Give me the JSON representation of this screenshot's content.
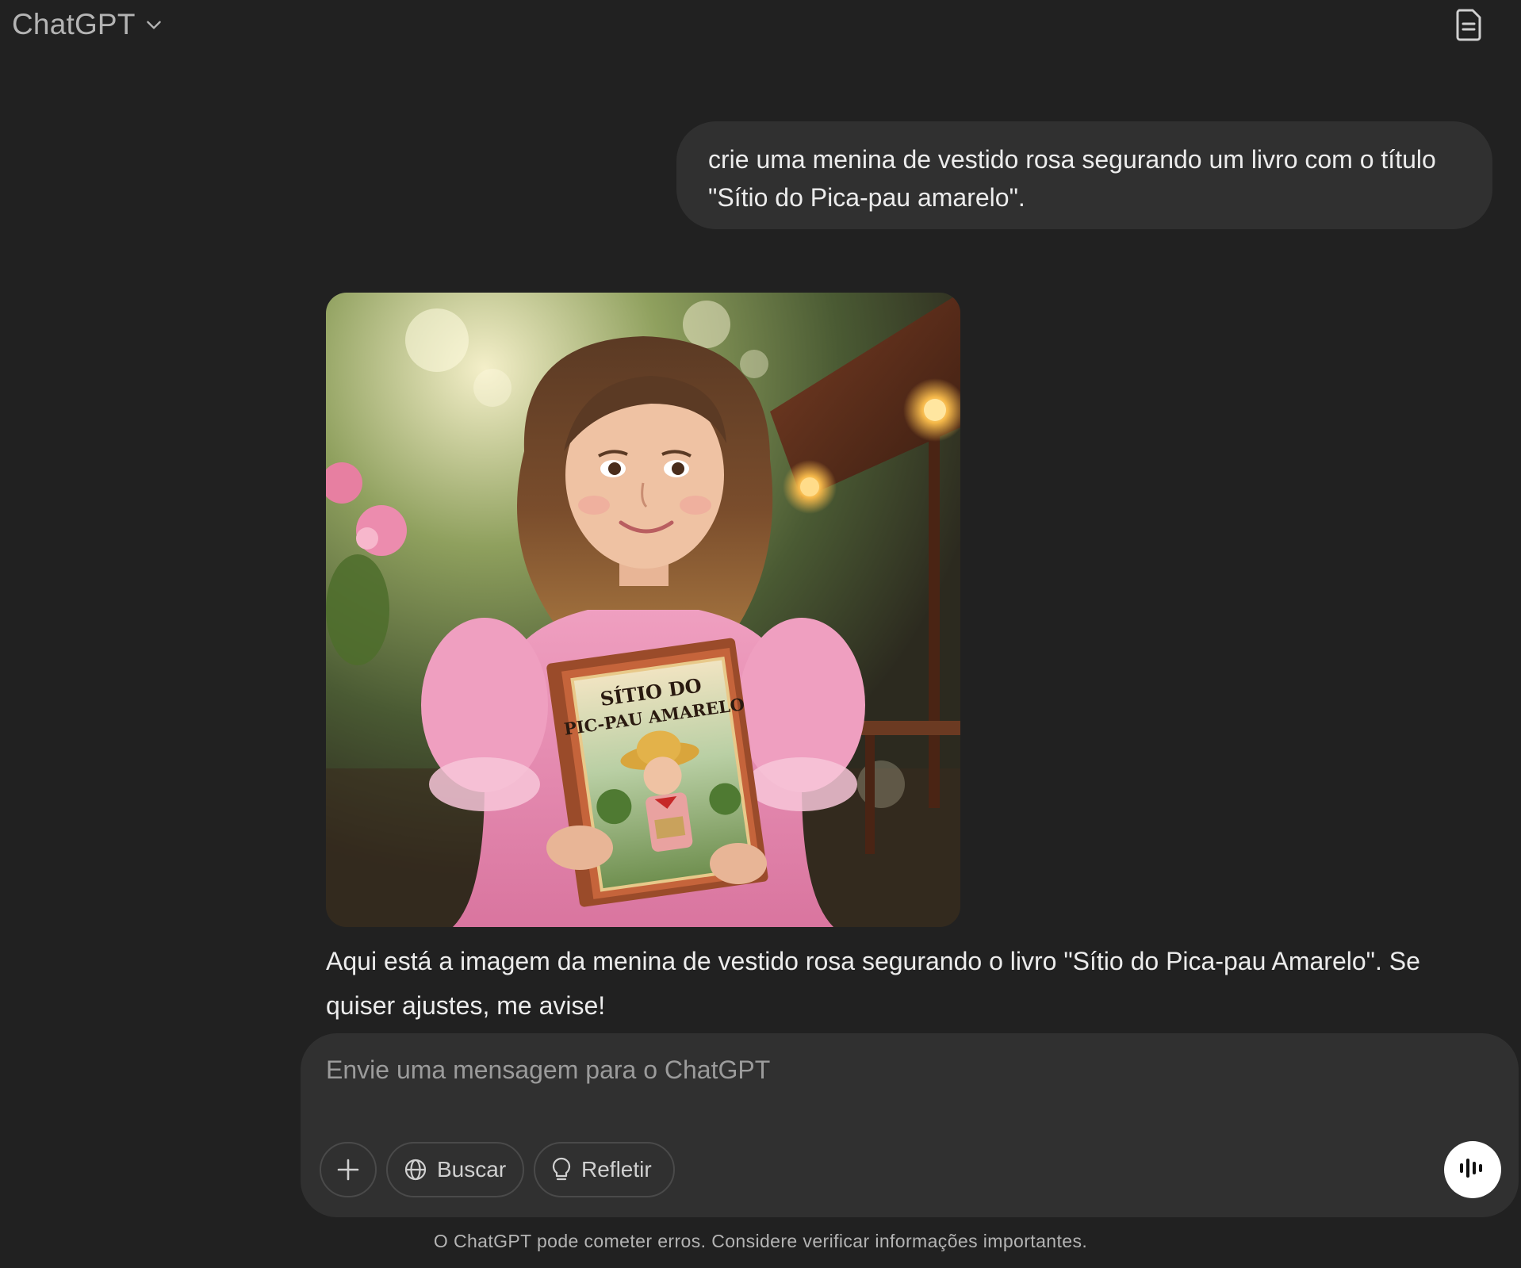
{
  "header": {
    "model_name": "ChatGPT",
    "chevron_icon": "chevron-down-icon",
    "right_icon": "document-icon"
  },
  "conversation": {
    "user_message": "crie uma menina de vestido rosa segurando um livro com o título \"Sítio do Pica-pau amarelo\".",
    "assistant_image": {
      "book_title_line1": "SÍTIO DO",
      "book_title_line2": "PIC-PAU AMARELO"
    },
    "assistant_message": "Aqui está a imagem da menina de vestido rosa segurando o livro \"Sítio do Pica-pau Amarelo\". Se quiser ajustes, me avise!"
  },
  "composer": {
    "placeholder": "Envie uma mensagem para o ChatGPT",
    "value": "",
    "buttons": {
      "plus_icon": "plus-icon",
      "search_label": "Buscar",
      "search_icon": "globe-icon",
      "reason_label": "Refletir",
      "reason_icon": "lightbulb-icon",
      "voice_icon": "voice-waveform-icon"
    }
  },
  "footer": {
    "disclaimer": "O ChatGPT pode cometer erros. Considere verificar informações importantes."
  },
  "colors": {
    "background": "#212121",
    "bubble": "#303030",
    "text": "#ececec",
    "muted": "#b4b4b4",
    "dress_pink": "#e58fb1"
  }
}
